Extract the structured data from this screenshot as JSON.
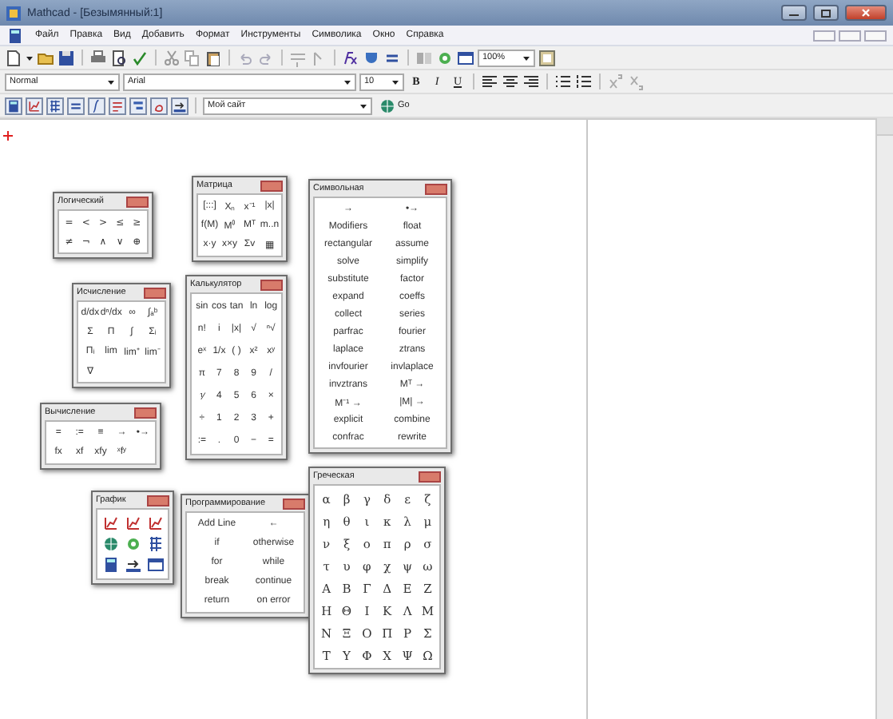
{
  "window": {
    "title": "Mathcad - [Безымянный:1]"
  },
  "menu": [
    "Файл",
    "Правка",
    "Вид",
    "Добавить",
    "Формат",
    "Инструменты",
    "Символика",
    "Окно",
    "Справка"
  ],
  "standard_bar": {
    "zoom": "100%"
  },
  "format_bar": {
    "style": "Normal",
    "font": "Arial",
    "size": "10",
    "bold": "B",
    "italic": "I",
    "underline": "U"
  },
  "resources_bar": {
    "address": "Мой сайт",
    "go": "Go"
  },
  "palettes": [
    {
      "title": "Логический",
      "kind": "grid",
      "rows": [
        [
          "=",
          "<",
          ">",
          "≤",
          "≥"
        ],
        [
          "≠",
          "¬",
          "∧",
          "∨",
          "⊕"
        ]
      ]
    },
    {
      "title": "Исчисление",
      "kind": "grid",
      "rows": [
        [
          "d/dx",
          "dⁿ/dx",
          "∞",
          "∫ₐᵇ"
        ],
        [
          "Σ",
          "Π",
          "∫",
          "Σᵢ"
        ],
        [
          "Πᵢ",
          "lim",
          "lim⁺",
          "lim⁻"
        ],
        [
          "∇"
        ]
      ]
    },
    {
      "title": "Вычисление",
      "kind": "grid",
      "rows": [
        [
          "=",
          ":=",
          "≡",
          "→",
          "•→"
        ],
        [
          "fx",
          "xf",
          "xfy",
          "ˣfʸ"
        ]
      ]
    },
    {
      "title": "График",
      "kind": "plot-icons"
    },
    {
      "title": "Матрица",
      "kind": "grid",
      "rows": [
        [
          "[:::]",
          "Xₙ",
          "x⁻¹",
          "|x|"
        ],
        [
          "f(M)",
          "M⁽⁾",
          "Mᵀ",
          "m..n"
        ],
        [
          "x·y",
          "x×y",
          "Σv",
          "▦"
        ]
      ]
    },
    {
      "title": "Калькулятор",
      "kind": "grid",
      "rows": [
        [
          "sin",
          "cos",
          "tan",
          "ln",
          "log"
        ],
        [
          "n!",
          "i",
          "|x|",
          "√",
          "ⁿ√"
        ],
        [
          "eˣ",
          "1/x",
          "( )",
          "x²",
          "xʸ"
        ],
        [
          "π",
          "7",
          "8",
          "9",
          "/"
        ],
        [
          "⅟",
          "4",
          "5",
          "6",
          "×"
        ],
        [
          "÷",
          "1",
          "2",
          "3",
          "+"
        ],
        [
          ":=",
          ".",
          "0",
          "−",
          "="
        ]
      ]
    },
    {
      "title": "Программирование",
      "kind": "grid",
      "rows": [
        [
          "Add Line",
          "←"
        ],
        [
          "if",
          "otherwise"
        ],
        [
          "for",
          "while"
        ],
        [
          "break",
          "continue"
        ],
        [
          "return",
          "on error"
        ]
      ]
    },
    {
      "title": "Символьная",
      "kind": "grid",
      "rows": [
        [
          "→",
          "•→"
        ],
        [
          "Modifiers",
          "float"
        ],
        [
          "rectangular",
          "assume"
        ],
        [
          "solve",
          "simplify"
        ],
        [
          "substitute",
          "factor"
        ],
        [
          "expand",
          "coeffs"
        ],
        [
          "collect",
          "series"
        ],
        [
          "parfrac",
          "fourier"
        ],
        [
          "laplace",
          "ztrans"
        ],
        [
          "invfourier",
          "invlaplace"
        ],
        [
          "invztrans",
          "Mᵀ →"
        ],
        [
          "M⁻¹ →",
          "|M| →"
        ],
        [
          "explicit",
          "combine"
        ],
        [
          "confrac",
          "rewrite"
        ]
      ]
    },
    {
      "title": "Греческая",
      "kind": "grid",
      "rows": [
        [
          "α",
          "β",
          "γ",
          "δ",
          "ε",
          "ζ"
        ],
        [
          "η",
          "θ",
          "ι",
          "κ",
          "λ",
          "μ"
        ],
        [
          "ν",
          "ξ",
          "ο",
          "π",
          "ρ",
          "σ"
        ],
        [
          "τ",
          "υ",
          "φ",
          "χ",
          "ψ",
          "ω"
        ],
        [
          "Α",
          "Β",
          "Γ",
          "Δ",
          "Ε",
          "Ζ"
        ],
        [
          "Η",
          "Θ",
          "Ι",
          "Κ",
          "Λ",
          "Μ"
        ],
        [
          "Ν",
          "Ξ",
          "Ο",
          "Π",
          "Ρ",
          "Σ"
        ],
        [
          "Τ",
          "Υ",
          "Φ",
          "Χ",
          "Ψ",
          "Ω"
        ]
      ]
    }
  ]
}
